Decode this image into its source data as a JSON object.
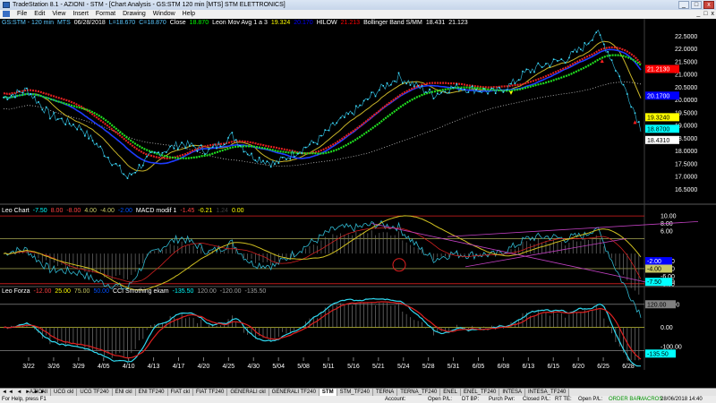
{
  "window": {
    "title": "TradeStation 8.1 - AZIONI - STM - [Chart Analysis - GS:STM  120 min  [MTS] STM ELETTRONICS]",
    "min": "_",
    "max": "□",
    "close": "x"
  },
  "menu": {
    "items": [
      "File",
      "Edit",
      "View",
      "Insert",
      "Format",
      "Drawing",
      "Window",
      "Help"
    ]
  },
  "price_panel": {
    "header": [
      {
        "text": "GS:STM - 120 min",
        "color": "#5ac8ff"
      },
      {
        "text": "MTS",
        "color": "#5ac8ff"
      },
      {
        "text": "06/28/2018",
        "color": "#ffffff"
      },
      {
        "text": "L=18.670",
        "color": "#5ac8ff"
      },
      {
        "text": "C=18.870",
        "color": "#5ac8ff"
      },
      {
        "text": "Close",
        "color": "#ffffff"
      },
      {
        "text": "18.870",
        "color": "#00ff00"
      },
      {
        "text": "Leon Mov Avg 1 a 3",
        "color": "#ffffff"
      },
      {
        "text": "19.324",
        "color": "#ffff00"
      },
      {
        "text": "20.170",
        "color": "#0000ff"
      },
      {
        "text": "HILOW",
        "color": "#ffffff"
      },
      {
        "text": "21.213",
        "color": "#ff0000"
      },
      {
        "text": "Bollinger Band S/MM",
        "color": "#ffffff"
      },
      {
        "text": "18.431",
        "color": "#ffffff"
      },
      {
        "text": "21.123",
        "color": "#ffffff"
      }
    ],
    "axis_labels": [
      "22.5000",
      "22.0000",
      "21.5000",
      "21.0000",
      "20.5000",
      "20.0000",
      "19.5000",
      "19.0000",
      "18.5000",
      "18.0000",
      "17.5000",
      "17.0000",
      "16.5000"
    ],
    "axis_values": [
      22.5,
      22.0,
      21.5,
      21.0,
      20.5,
      20.0,
      19.5,
      19.0,
      18.5,
      18.0,
      17.5,
      17.0,
      16.5
    ],
    "tags": [
      {
        "text": "21.2130",
        "value": 21.213,
        "bg": "#ff0000",
        "fg": "#ffffff"
      },
      {
        "text": "20.1700",
        "value": 20.17,
        "bg": "#0000ff",
        "fg": "#ffffff"
      },
      {
        "text": "19.3240",
        "value": 19.324,
        "bg": "#ffff00",
        "fg": "#000000"
      },
      {
        "text": "18.8700",
        "value": 18.87,
        "bg": "#00ffff",
        "fg": "#000000"
      },
      {
        "text": "18.4310",
        "value": 18.431,
        "bg": "#ffffff",
        "fg": "#000000"
      }
    ]
  },
  "macd_panel": {
    "header": [
      {
        "text": "Leo Chart",
        "color": "#ffffff"
      },
      {
        "text": "-7.50",
        "color": "#00ffff"
      },
      {
        "text": "8.00",
        "color": "#ff4040"
      },
      {
        "text": "-8.00",
        "color": "#ff4040"
      },
      {
        "text": "4.00",
        "color": "#c8c864"
      },
      {
        "text": "-4.00",
        "color": "#c8c864"
      },
      {
        "text": "-2.00",
        "color": "#0050ff"
      },
      {
        "text": "MACD modif 1",
        "color": "#ffffff"
      },
      {
        "text": "-1.45",
        "color": "#ff4040"
      },
      {
        "text": "-0.21",
        "color": "#ffff00"
      },
      {
        "text": "1.24",
        "color": "#404040"
      },
      {
        "text": "0.00",
        "color": "#ffff00"
      }
    ],
    "axis_labels": [
      "10.00",
      "8.00",
      "6.00",
      "-2.00",
      "-4.00",
      "-6.00",
      "-7.50",
      "-8.00"
    ],
    "axis_values": [
      10,
      8,
      6,
      -2,
      -4,
      -6,
      -7.5,
      -8
    ],
    "tags": [
      {
        "text": "-2.00",
        "value": -2.0,
        "bg": "#0000ff",
        "fg": "#ffffff"
      },
      {
        "text": "-4.00",
        "value": -4.0,
        "bg": "#c8c864",
        "fg": "#000000"
      },
      {
        "text": "-7.50",
        "value": -7.5,
        "bg": "#00ffff",
        "fg": "#000000"
      }
    ]
  },
  "cci_panel": {
    "header": [
      {
        "text": "Leo Forza",
        "color": "#ffffff"
      },
      {
        "text": "-12.00",
        "color": "#ff4040"
      },
      {
        "text": "25.00",
        "color": "#ffff00"
      },
      {
        "text": "75.00",
        "color": "#c8c864"
      },
      {
        "text": "50.00",
        "color": "#0050ff"
      },
      {
        "text": "CCI Smothing ekam",
        "color": "#ffffff"
      },
      {
        "text": "-135.50",
        "color": "#00ffff"
      },
      {
        "text": "120.00",
        "color": "#a0a0a0"
      },
      {
        "text": "-120.00",
        "color": "#a0a0a0"
      },
      {
        "text": "-135.50",
        "color": "#a0a0a0"
      }
    ],
    "axis_labels": [
      "120.00",
      "0.00",
      "-100.00"
    ],
    "axis_values": [
      120,
      0,
      -100
    ],
    "tags": [
      {
        "text": "120.00",
        "value": 120,
        "bg": "#808080",
        "fg": "#000000"
      },
      {
        "text": "-135.50",
        "value": -135.5,
        "bg": "#00ffff",
        "fg": "#000000"
      }
    ]
  },
  "dates": [
    "3/22",
    "3/26",
    "3/29",
    "4/05",
    "4/10",
    "4/13",
    "4/17",
    "4/20",
    "4/25",
    "4/30",
    "5/04",
    "5/08",
    "5/11",
    "5/16",
    "5/21",
    "5/24",
    "5/28",
    "5/31",
    "6/05",
    "6/08",
    "6/13",
    "6/15",
    "6/20",
    "6/25",
    "6/28"
  ],
  "tabs": {
    "nav": "◄◄ ◄ ► ►►",
    "items": [
      "AZIONI",
      "UCG ckl",
      "UCG TF240",
      "ENI ckl",
      "ENI TF240",
      "FIAT ckl",
      "FIAT TF240",
      "GENERALI ckl",
      "GENERALI TF240",
      "STM",
      "STM_TF240",
      "TERNA",
      "TERNA_TF240",
      "ENEL",
      "ENEL_TF240",
      "INTESA",
      "INTESA_TF240"
    ],
    "active": "STM"
  },
  "status": {
    "help": "For Help, press F1",
    "account": "Account:",
    "open_pnl": "Open P/L:",
    "dt_bp": "DT BP:",
    "purch_pwr": "Purch Pwr:",
    "closed_pnl": "Closed P/L:",
    "rt_te": "RT TE:",
    "open_pl2": "Open P/L:",
    "order_bar": "ORDER BAR",
    "macros": "MACROS",
    "datetime": "28/06/2018 14:40"
  }
}
